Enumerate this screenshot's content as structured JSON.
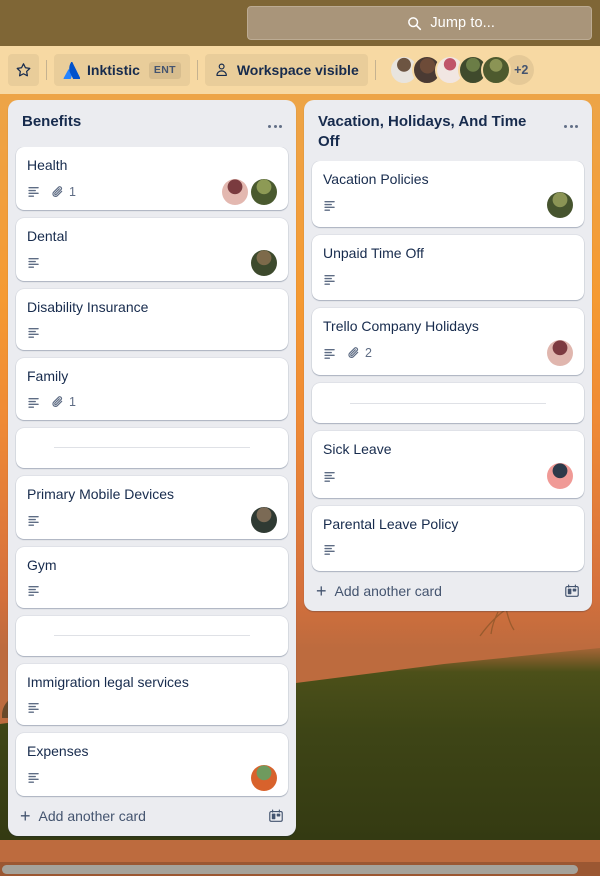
{
  "topbar": {
    "search": {
      "placeholder": "Jump to...",
      "icon": "search-icon",
      "value": ""
    }
  },
  "board_header": {
    "star": {
      "icon": "star-icon",
      "label": ""
    },
    "workspace": {
      "icon": "atlassian-logo-icon",
      "name": "Inktistic",
      "plan_badge": "ENT"
    },
    "visibility": {
      "icon": "workspace-visible-icon",
      "label": "Workspace visible"
    },
    "members": {
      "avatars": [
        {
          "name": "member-avatar-1",
          "color_a": "#e8e4de",
          "color_b": "#6d5542"
        },
        {
          "name": "member-avatar-2",
          "color_a": "#4a3a33",
          "color_b": "#9a7a5f"
        },
        {
          "name": "member-avatar-3",
          "color_a": "#f1e6e2",
          "color_b": "#c0546a"
        },
        {
          "name": "member-avatar-4",
          "color_a": "#3f4a2c",
          "color_b": "#6b7d46"
        },
        {
          "name": "member-avatar-5",
          "color_a": "#4d5a2e",
          "color_b": "#8b9455"
        }
      ],
      "overflow_label": "+2"
    }
  },
  "colors": {
    "accent_blue": "#0c66e4",
    "atlassian_blue": "#2684ff",
    "header_bg": "#f7d9a3",
    "topbar_bg": "#7f6636",
    "list_bg": "#ebecf0",
    "card_bg": "#ffffff",
    "text_primary": "#172b4d",
    "text_subtle": "#5e6c84"
  },
  "lists": [
    {
      "name": "list-benefits",
      "title": "Benefits",
      "menu_icon": "list-menu-icon",
      "add_card": {
        "label": "Add another card",
        "plus_icon": "plus-icon",
        "template_icon": "card-template-icon"
      },
      "has_scrollbar": true,
      "cards": [
        {
          "name": "card-health",
          "title": "Health",
          "description_icon": true,
          "attachment_count": "1",
          "avatars": [
            {
              "name": "card-avatar-1",
              "color_a": "#e3b8b0",
              "color_b": "#7a3b3f"
            },
            {
              "name": "card-avatar-2",
              "color_a": "#4a5a2f",
              "color_b": "#8d9a55"
            }
          ]
        },
        {
          "name": "card-dental",
          "title": "Dental",
          "description_icon": true,
          "attachment_count": "",
          "avatars": [
            {
              "name": "card-avatar-3",
              "color_a": "#3d4a2d",
              "color_b": "#7d6a4a"
            }
          ]
        },
        {
          "name": "card-disability-insurance",
          "title": "Disability Insurance",
          "description_icon": true,
          "attachment_count": "",
          "avatars": []
        },
        {
          "name": "card-family",
          "title": "Family",
          "description_icon": true,
          "attachment_count": "1",
          "avatars": []
        },
        {
          "name": "card-separator-1",
          "title": "",
          "separator": true,
          "description_icon": false,
          "attachment_count": "",
          "avatars": []
        },
        {
          "name": "card-primary-mobile-devices",
          "title": "Primary Mobile Devices",
          "description_icon": true,
          "attachment_count": "",
          "avatars": [
            {
              "name": "card-avatar-4",
              "color_a": "#2f3a33",
              "color_b": "#7b6a55"
            }
          ]
        },
        {
          "name": "card-gym",
          "title": "Gym",
          "description_icon": true,
          "attachment_count": "",
          "avatars": []
        },
        {
          "name": "card-separator-2",
          "title": "",
          "separator": true,
          "description_icon": false,
          "attachment_count": "",
          "avatars": []
        },
        {
          "name": "card-immigration-legal-services",
          "title": "Immigration legal services",
          "description_icon": true,
          "attachment_count": "",
          "avatars": []
        },
        {
          "name": "card-expenses",
          "title": "Expenses",
          "description_icon": true,
          "attachment_count": "",
          "avatars": [
            {
              "name": "card-avatar-5",
              "color_a": "#d8622c",
              "color_b": "#6f9a5e"
            }
          ]
        }
      ]
    },
    {
      "name": "list-vacation-holidays-and-time-off",
      "title": "Vacation, Holidays, And Time Off",
      "menu_icon": "list-menu-icon",
      "add_card": {
        "label": "Add another card",
        "plus_icon": "plus-icon",
        "template_icon": "card-template-icon"
      },
      "has_scrollbar": false,
      "cards": [
        {
          "name": "card-vacation-policies",
          "title": "Vacation Policies",
          "description_icon": true,
          "attachment_count": "",
          "avatars": [
            {
              "name": "card-avatar-6",
              "color_a": "#46542e",
              "color_b": "#8b9455"
            }
          ]
        },
        {
          "name": "card-unpaid-time-off",
          "title": "Unpaid Time Off",
          "description_icon": true,
          "attachment_count": "",
          "avatars": []
        },
        {
          "name": "card-trello-company-holidays",
          "title": "Trello Company Holidays",
          "description_icon": true,
          "attachment_count": "2",
          "avatars": [
            {
              "name": "card-avatar-7",
              "color_a": "#e0b6ae",
              "color_b": "#7d3a40"
            }
          ]
        },
        {
          "name": "card-separator-3",
          "title": "",
          "separator": true,
          "description_icon": false,
          "attachment_count": "",
          "avatars": []
        },
        {
          "name": "card-sick-leave",
          "title": "Sick Leave",
          "description_icon": true,
          "attachment_count": "",
          "avatars": [
            {
              "name": "card-avatar-8",
              "color_a": "#f09a96",
              "color_b": "#2e3a4a"
            }
          ]
        },
        {
          "name": "card-parental-leave-policy",
          "title": "Parental Leave Policy",
          "description_icon": true,
          "attachment_count": "",
          "avatars": []
        }
      ]
    }
  ]
}
